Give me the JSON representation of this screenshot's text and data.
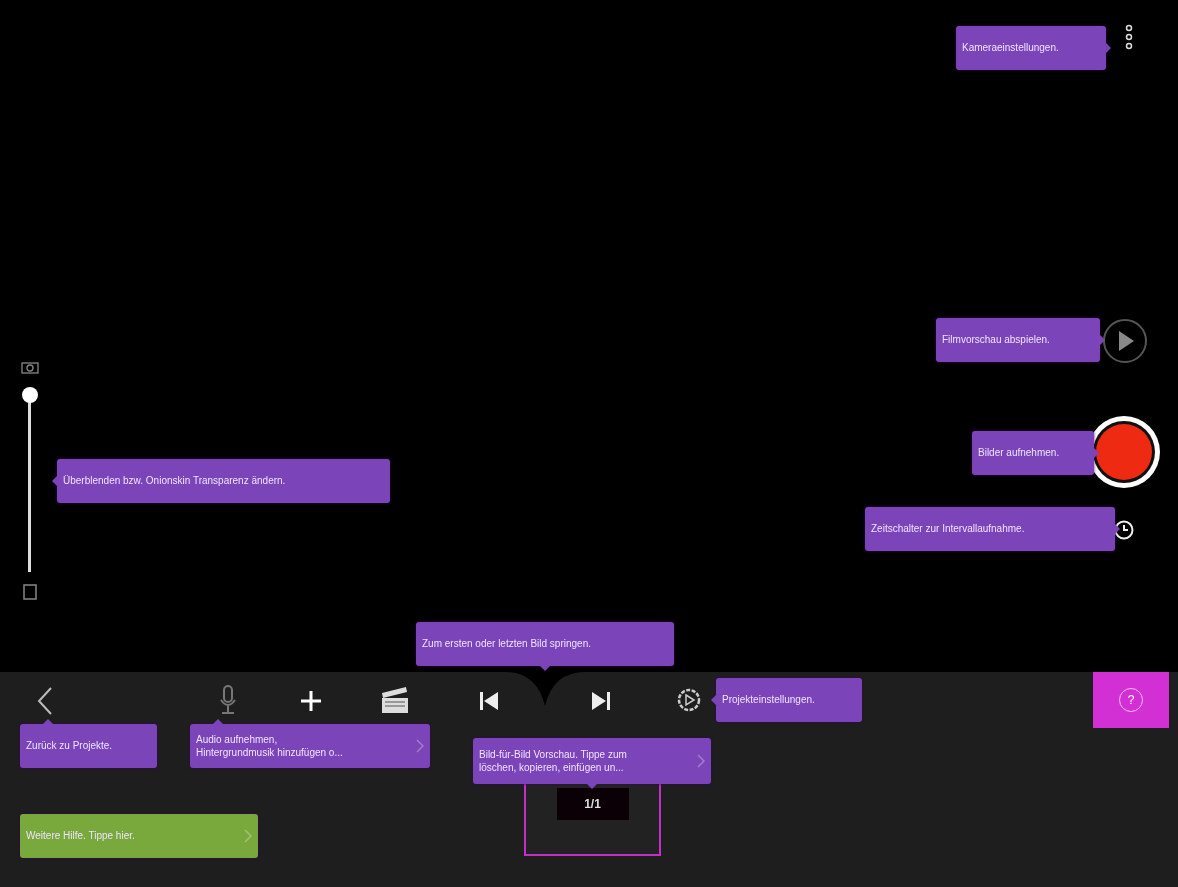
{
  "transparency_slider": {
    "level": 1
  },
  "tooltips": [
    {
      "kind": "hint",
      "lines": [
        "Kameraeinstellungen."
      ],
      "more": false
    },
    {
      "kind": "hint",
      "lines": [
        "Filmvorschau abspielen."
      ],
      "more": false
    },
    {
      "kind": "hint",
      "lines": [
        "Bilder aufnehmen."
      ],
      "more": false
    },
    {
      "kind": "hint",
      "lines": [
        "Zeitschalter zur Intervallaufnahme."
      ],
      "more": false
    },
    {
      "kind": "hint",
      "lines": [
        "Überblenden bzw. Onionskin Transparenz ändern."
      ],
      "more": false
    },
    {
      "kind": "hint",
      "lines": [
        "Zum ersten oder letzten Bild springen."
      ],
      "more": false
    },
    {
      "kind": "hint",
      "lines": [
        "Projekteinstellungen."
      ],
      "more": false
    },
    {
      "kind": "hint",
      "lines": [
        "Zurück zu Projekte."
      ],
      "more": false
    },
    {
      "kind": "hint",
      "lines": [
        "Audio aufnehmen,",
        "Hintergrundmusik hinzufügen o..."
      ],
      "more": true
    },
    {
      "kind": "hint",
      "lines": [
        "Bild-für-Bild Vorschau. Tippe zum",
        "löschen, kopieren, einfügen un..."
      ],
      "more": true
    },
    {
      "kind": "help",
      "lines": [
        "Weitere Hilfe. Tippe hier."
      ],
      "more": true
    }
  ],
  "frame_strip": {
    "counter": "1/1"
  },
  "help_button": {
    "label": "?"
  }
}
